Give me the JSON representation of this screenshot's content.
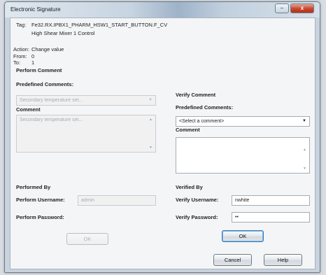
{
  "window": {
    "title": "Electronic Signature"
  },
  "controls": {
    "minimize": "–",
    "close": "x"
  },
  "tag": {
    "label": "Tag:",
    "value": "Fe32.RX.IPBX1_PHARM_HSW1_START_BUTTON.F_CV",
    "description": "High Shear Mixer 1 Control"
  },
  "action": {
    "action_label": "Action:",
    "action_value": "Change value",
    "from_label": "From:",
    "from_value": "0",
    "to_label": "To:",
    "to_value": "1"
  },
  "perform": {
    "section_title": "Perform Comment",
    "predefined_label": "Predefined Comments:",
    "predefined_value": "Secondary temperature set...",
    "comment_label": "Comment",
    "comment_value": "Secondary temperature set...",
    "by_label": "Performed By",
    "username_label": "Perform Username:",
    "username_value": "admin",
    "password_label": "Perform Password:",
    "password_value": "",
    "ok_label": "OK"
  },
  "verify": {
    "section_title": "Verify Comment",
    "predefined_label": "Predefined Comments:",
    "predefined_value": "<Select a comment>",
    "comment_label": "Comment",
    "comment_value": "",
    "by_label": "Verified By",
    "username_label": "Verify Username:",
    "username_value": "nwhite",
    "password_label": "Verify Password:",
    "password_value": "••",
    "ok_label": "OK"
  },
  "footer": {
    "cancel_label": "Cancel",
    "help_label": "Help"
  }
}
